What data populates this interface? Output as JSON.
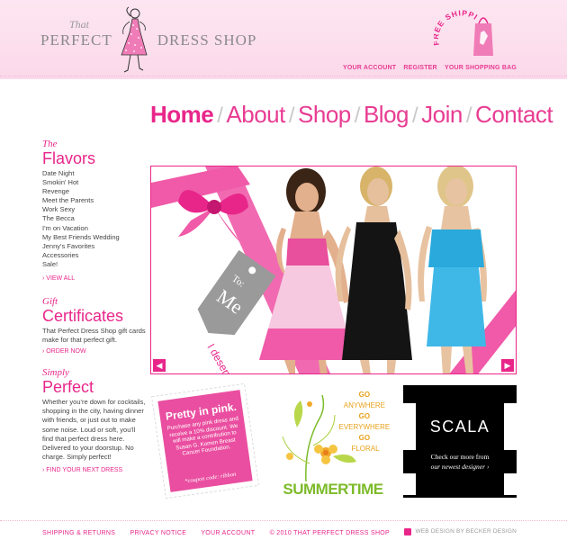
{
  "brand": {
    "that": "That",
    "left": "PERFECT",
    "right": "DRESS SHOP"
  },
  "free_shipping": "FREE SHIPPING",
  "top_nav": {
    "account": "YOUR ACCOUNT",
    "register": "REGISTER",
    "bag": "YOUR SHOPPING BAG"
  },
  "main_nav": [
    "Home",
    "About",
    "Shop",
    "Blog",
    "Join",
    "Contact"
  ],
  "sidebar": {
    "flavors": {
      "pre": "The",
      "title": "Flavors",
      "items": [
        "Date Night",
        "Smokin' Hot",
        "Revenge",
        "Meet the Parents",
        "Work Sexy",
        "The Becca",
        "I'm on Vacation",
        "My Best Friends Wedding",
        "Jenny's Favorites",
        "Accessories",
        "Sale!"
      ],
      "link": "› VIEW ALL"
    },
    "gift": {
      "pre": "Gift",
      "title": "Certificates",
      "text": "That Perfect Dress Shop gift cards make for that perfect gift.",
      "link": "› ORDER NOW"
    },
    "simply": {
      "pre": "Simply",
      "title": "Perfect",
      "text": "Whether you're down for cocktails, shopping in the city, having dinner with friends, or just out to make some noise. Loud or soft, you'll find that perfect dress here. Delivered to your doorstup. No charge. Simply perfect!",
      "link": "› FIND YOUR NEXT DRESS"
    }
  },
  "hero": {
    "tag_to": "To:",
    "tag_me": "Me",
    "tagline": "I deserve it."
  },
  "promos": {
    "pink": {
      "title": "Pretty in pink.",
      "body": "Purchase any pink dress and receive a 10% discount. We will make a contribution to Susan G. Komen Breast Cancer Foundation.",
      "code": "*coupon code: ribbon"
    },
    "summer": {
      "lines": [
        "GO",
        "ANYWHERE",
        "GO",
        "EVERYWHERE",
        "GO",
        "FLORAL"
      ],
      "title": "SUMMERTIME"
    },
    "scala": {
      "title": "SCALA",
      "line1": "Check our more from",
      "line2": "our newest designer ›"
    }
  },
  "footer": {
    "shipping": "SHIPPING & RETURNS",
    "privacy": "PRIVACY NOTICE",
    "account": "YOUR ACCOUNT",
    "copyright": "© 2010 THAT PERFECT DRESS SHOP",
    "credit": "WEB DESIGN BY BECKER DESIGN"
  },
  "colors": {
    "accent": "#e8268a",
    "header_bg": "#fbd9ea",
    "scala_bg": "#000000",
    "summer_green": "#7dbb2a"
  }
}
